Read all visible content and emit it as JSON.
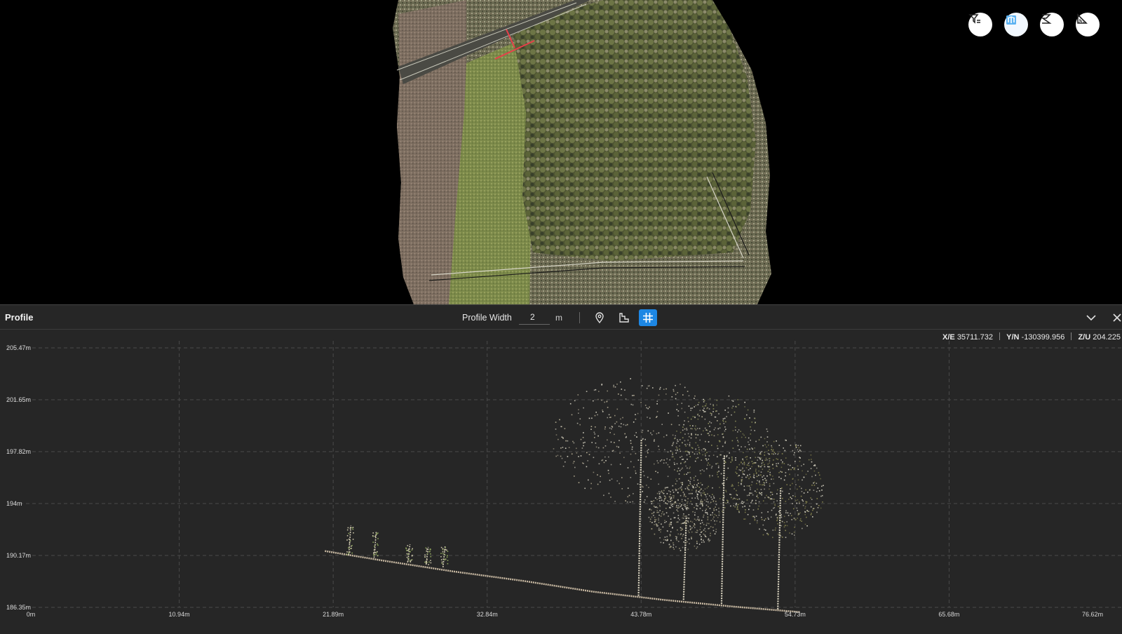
{
  "viewport": {
    "toolbar": {
      "filter_icon": "filter-icon",
      "map_icon": "map-layer-icon",
      "profile_icon": "profile-path-icon",
      "measure_icon": "measure-ruler-icon"
    },
    "colors": {
      "accent": "#1d87e4",
      "section_line": "#e8404a"
    }
  },
  "profile": {
    "title": "Profile",
    "width_label": "Profile Width",
    "width_value": "2",
    "width_unit": "m",
    "tools": [
      {
        "name": "point-marker",
        "icon": "location-pin-icon",
        "active": false
      },
      {
        "name": "elevation",
        "icon": "elevation-steps-icon",
        "active": false
      },
      {
        "name": "grid",
        "icon": "grid-icon",
        "active": true
      }
    ],
    "coords": {
      "x_label": "X/E",
      "x_value": "35711.732",
      "y_label": "Y/N",
      "y_value": "-130399.956",
      "z_label": "Z/U",
      "z_value": "204.225"
    }
  },
  "chart_data": {
    "type": "scatter",
    "x_ticks": [
      "0m",
      "10.94m",
      "21.89m",
      "32.84m",
      "43.78m",
      "54.73m",
      "65.68m",
      "76.62m"
    ],
    "y_ticks": [
      "186.35m",
      "190.17m",
      "194m",
      "197.82m",
      "201.65m",
      "205.47m"
    ],
    "xlim": [
      0,
      76.62
    ],
    "ylim": [
      186.35,
      205.47
    ],
    "grid": true,
    "ground": [
      [
        20.9,
        190.5
      ],
      [
        25,
        189.8
      ],
      [
        30,
        189.0
      ],
      [
        35,
        188.3
      ],
      [
        40,
        187.5
      ],
      [
        45,
        186.9
      ],
      [
        50,
        186.4
      ],
      [
        54.7,
        186.0
      ]
    ],
    "trees": [
      {
        "x": 43.2,
        "base": 187.2,
        "top": 203.2,
        "canopy_r": 6.2,
        "color": "#b9b096"
      },
      {
        "x": 49.1,
        "base": 186.6,
        "top": 201.8,
        "canopy_r": 3.6,
        "color": "#8d8f5a"
      },
      {
        "x": 53.1,
        "base": 186.2,
        "top": 198.6,
        "canopy_r": 3.3,
        "color": "#8a874f"
      },
      {
        "x": 46.4,
        "base": 186.9,
        "top": 195.5,
        "canopy_r": 2.6,
        "color": "#9a9476"
      }
    ],
    "shrubs": [
      {
        "x": 22.6,
        "base": 190.2,
        "top": 192.4
      },
      {
        "x": 24.4,
        "base": 190.0,
        "top": 191.9
      },
      {
        "x": 26.8,
        "base": 189.7,
        "top": 191.0
      },
      {
        "x": 28.1,
        "base": 189.5,
        "top": 190.8
      },
      {
        "x": 29.3,
        "base": 189.3,
        "top": 190.9
      }
    ]
  }
}
